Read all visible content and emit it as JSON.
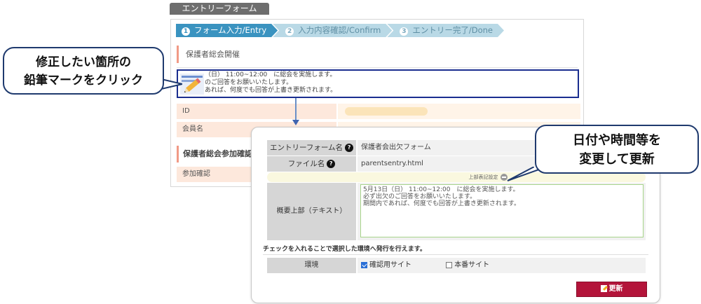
{
  "form_tab": "エントリーフォーム",
  "steps": [
    {
      "num": "1",
      "label": "フォーム入力/Entry"
    },
    {
      "num": "2",
      "label": "入力内容確認/Confirm"
    },
    {
      "num": "3",
      "label": "エントリー完了/Done"
    }
  ],
  "base": {
    "section_title": "保護者総会開催",
    "desc_lines": [
      "（日） 11:00~12:00　に総会を実施します。",
      "のご回答をお願いいたします。",
      "あれば、何度でも回答が上書き更新されます。"
    ],
    "row_id_label": "ID",
    "row_member_label": "会員名",
    "confirm_head": "保護者総会参加確認",
    "row_participate_label": "参加確認"
  },
  "callout_left": {
    "line1": "修正したい箇所の",
    "line2": "鉛筆マークをクリック"
  },
  "callout_right": {
    "line1": "日付や時間等を",
    "line2": "変更して更新"
  },
  "dialog": {
    "form_name_label": "エントリーフォーム名",
    "form_name_value": "保護者会出欠フォーム",
    "file_name_label": "ファイル名",
    "file_name_value": "parentsentry.html",
    "upper_setting": "上部表記設定",
    "summary_label": "概要上部（テキスト）",
    "summary_lines": [
      "5月13日（日） 11:00~12:00　に総会を実施します。",
      "必ず出欠のご回答をお願いいたします。",
      "期間内であれば、何度でも回答が上書き更新されます。"
    ],
    "check_note": "チェックを入れることで選択した環境へ発行を行えます。",
    "env_label": "環境",
    "env_options": [
      {
        "label": "確認用サイト",
        "checked": true
      },
      {
        "label": "本番サイト",
        "checked": false
      }
    ],
    "update_button": "更新"
  }
}
